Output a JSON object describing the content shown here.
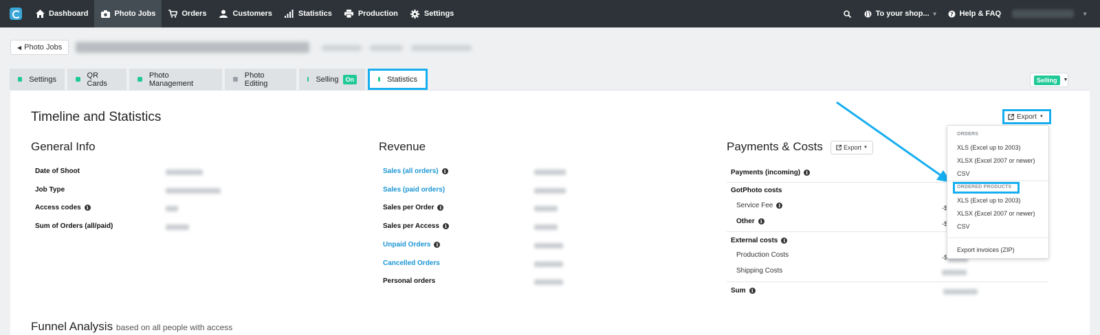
{
  "navbar": {
    "items": [
      {
        "label": "Dashboard",
        "icon": "home-icon",
        "active": false
      },
      {
        "label": "Photo Jobs",
        "icon": "camera-icon",
        "active": true
      },
      {
        "label": "Orders",
        "icon": "cart-icon",
        "active": false
      },
      {
        "label": "Customers",
        "icon": "user-icon",
        "active": false
      },
      {
        "label": "Statistics",
        "icon": "bar-chart-icon",
        "active": false
      },
      {
        "label": "Production",
        "icon": "printer-icon",
        "active": false
      },
      {
        "label": "Settings",
        "icon": "gear-icon",
        "active": false
      }
    ],
    "shop_label": "To your shop...",
    "help_label": "Help & FAQ"
  },
  "header": {
    "back_label": "Photo Jobs"
  },
  "tabs": [
    {
      "label": "Settings",
      "status": "green"
    },
    {
      "label": "QR Cards",
      "status": "green"
    },
    {
      "label": "Photo Management",
      "status": "green"
    },
    {
      "label": "Photo Editing",
      "status": "grey"
    },
    {
      "label": "Selling",
      "status": "green",
      "badge": "On"
    },
    {
      "label": "Statistics",
      "status": "green",
      "active": true
    }
  ],
  "selling_badge": "Selling",
  "main": {
    "title": "Timeline and Statistics",
    "export_label": "Export",
    "general": {
      "title": "General Info",
      "rows": [
        "Date of Shoot",
        "Job Type",
        "Access codes",
        "Sum of Orders (all/paid)"
      ]
    },
    "revenue": {
      "title": "Revenue",
      "rows": [
        "Sales (all orders)",
        "Sales (paid orders)",
        "Sales per Order",
        "Sales per Access",
        "Unpaid Orders",
        "Cancelled Orders",
        "Personal orders"
      ]
    },
    "payments": {
      "title": "Payments & Costs",
      "export_label": "Export",
      "incoming": "Payments (incoming)",
      "gotphoto": "GotPhoto costs",
      "service_fee": "Service Fee",
      "other": "Other",
      "external": "External costs",
      "production": "Production Costs",
      "shipping": "Shipping Costs",
      "sum": "Sum",
      "partial_1": "-$",
      "partial_2": "-$",
      "partial_3": "-$"
    },
    "funnel_title": "Funnel Analysis",
    "funnel_sub": "based on all people with access"
  },
  "dropdown": {
    "orders_header": "ORDERS",
    "orders_items": [
      "XLS (Excel up to 2003)",
      "XLSX (Excel 2007 or newer)",
      "CSV"
    ],
    "products_header": "ORDERED PRODUCTS",
    "products_items": [
      "XLS (Excel up to 2003)",
      "XLSX (Excel 2007 or newer)",
      "CSV"
    ],
    "invoices": "Export invoices (ZIP)"
  },
  "colors": {
    "navbar": "#2d3338",
    "accent_green": "#20c997",
    "link_blue": "#1a96d4",
    "highlight": "#16aef0"
  }
}
